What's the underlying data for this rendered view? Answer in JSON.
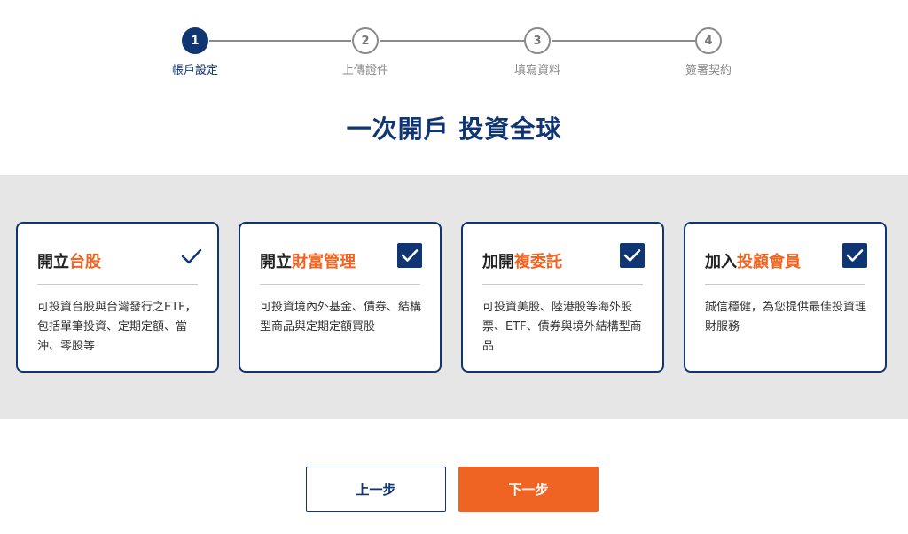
{
  "stepper": {
    "steps": [
      {
        "number": "1",
        "label": "帳戶設定",
        "state": "active"
      },
      {
        "number": "2",
        "label": "上傳證件",
        "state": "inactive"
      },
      {
        "number": "3",
        "label": "填寫資料",
        "state": "inactive"
      },
      {
        "number": "4",
        "label": "簽署契約",
        "state": "inactive"
      }
    ]
  },
  "headline": "一次開戶 投資全球",
  "cards": [
    {
      "title_prefix": "開立",
      "title_highlight": "台股",
      "description": "可投資台股與台灣發行之ETF，包括單筆投資、定期定額、當沖、零股等",
      "checked": true,
      "check_style": "plain"
    },
    {
      "title_prefix": "開立",
      "title_highlight": "財富管理",
      "description": "可投資境內外基金、債券、結構型商品與定期定額買股",
      "checked": true,
      "check_style": "box"
    },
    {
      "title_prefix": "加開",
      "title_highlight": "複委託",
      "description": "可投資美股、陸港股等海外股票、ETF、債券與境外結構型商品",
      "checked": true,
      "check_style": "box"
    },
    {
      "title_prefix": "加入",
      "title_highlight": "投顧會員",
      "description": "誠信穩健，為您提供最佳投資理財服務",
      "checked": true,
      "check_style": "box"
    }
  ],
  "buttons": {
    "prev_label": "上一步",
    "next_label": "下一步"
  },
  "colors": {
    "brand_navy": "#0f3673",
    "accent_orange": "#ef6422",
    "band_gray": "#e6e6e6"
  }
}
